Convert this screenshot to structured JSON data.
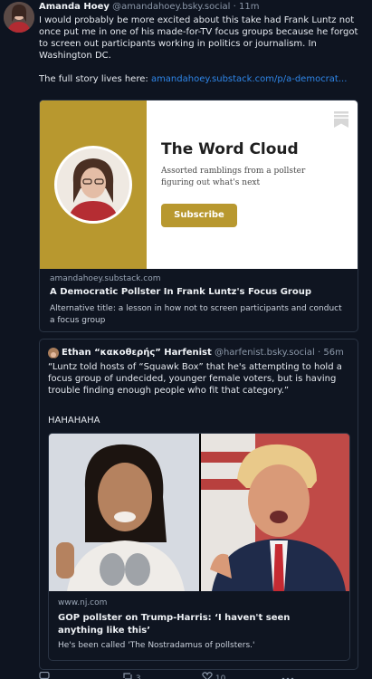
{
  "post": {
    "author_name": "Amanda Hoey",
    "author_handle": "@amandahoey.bsky.social",
    "separator": "·",
    "time": "11m",
    "text": "I would probably be more excited about this take had Frank Luntz not once put me in one of his made-for-TV focus groups because he forgot to screen out participants working in politics or journalism. In Washington DC.",
    "story_prefix": "The full story lives here: ",
    "story_link": "amandahoey.substack.com/p/a-democrat..."
  },
  "link_card": {
    "banner_title": "The Word Cloud",
    "banner_subtitle": "Assorted ramblings from a pollster figuring out what's next",
    "subscribe_label": "Subscribe",
    "domain": "amandahoey.substack.com",
    "title": "A Democratic Pollster In Frank Luntz's Focus Group",
    "description": "Alternative title: a lesson in how not to screen participants and conduct a focus group"
  },
  "quoted_post": {
    "author_name": "Ethan “κακοθερής” Harfenist",
    "author_handle": "@harfenist.bsky.social",
    "separator": "·",
    "time": "56m",
    "text": "“Luntz told hosts of “Squawk Box” that he's attempting to hold a focus group of undecided, younger female voters, but is having trouble finding enough people who fit that category.”",
    "reaction": "HAHAHAHA",
    "card": {
      "domain": "www.nj.com",
      "title": "GOP pollster on Trump-Harris: ‘I haven't seen anything like this’",
      "description": "He's been called 'The Nostradamus of pollsters.'"
    }
  },
  "actions": {
    "reply_count": "",
    "repost_count": "3",
    "like_count": "10"
  },
  "icons": {
    "bookmark": "bookmark-icon",
    "reply": "reply-icon",
    "repost": "repost-icon",
    "like": "heart-icon",
    "more": "more-icon"
  },
  "colors": {
    "background": "#0e1420",
    "link": "#2f86e8",
    "substack_gold": "#b8982f"
  }
}
